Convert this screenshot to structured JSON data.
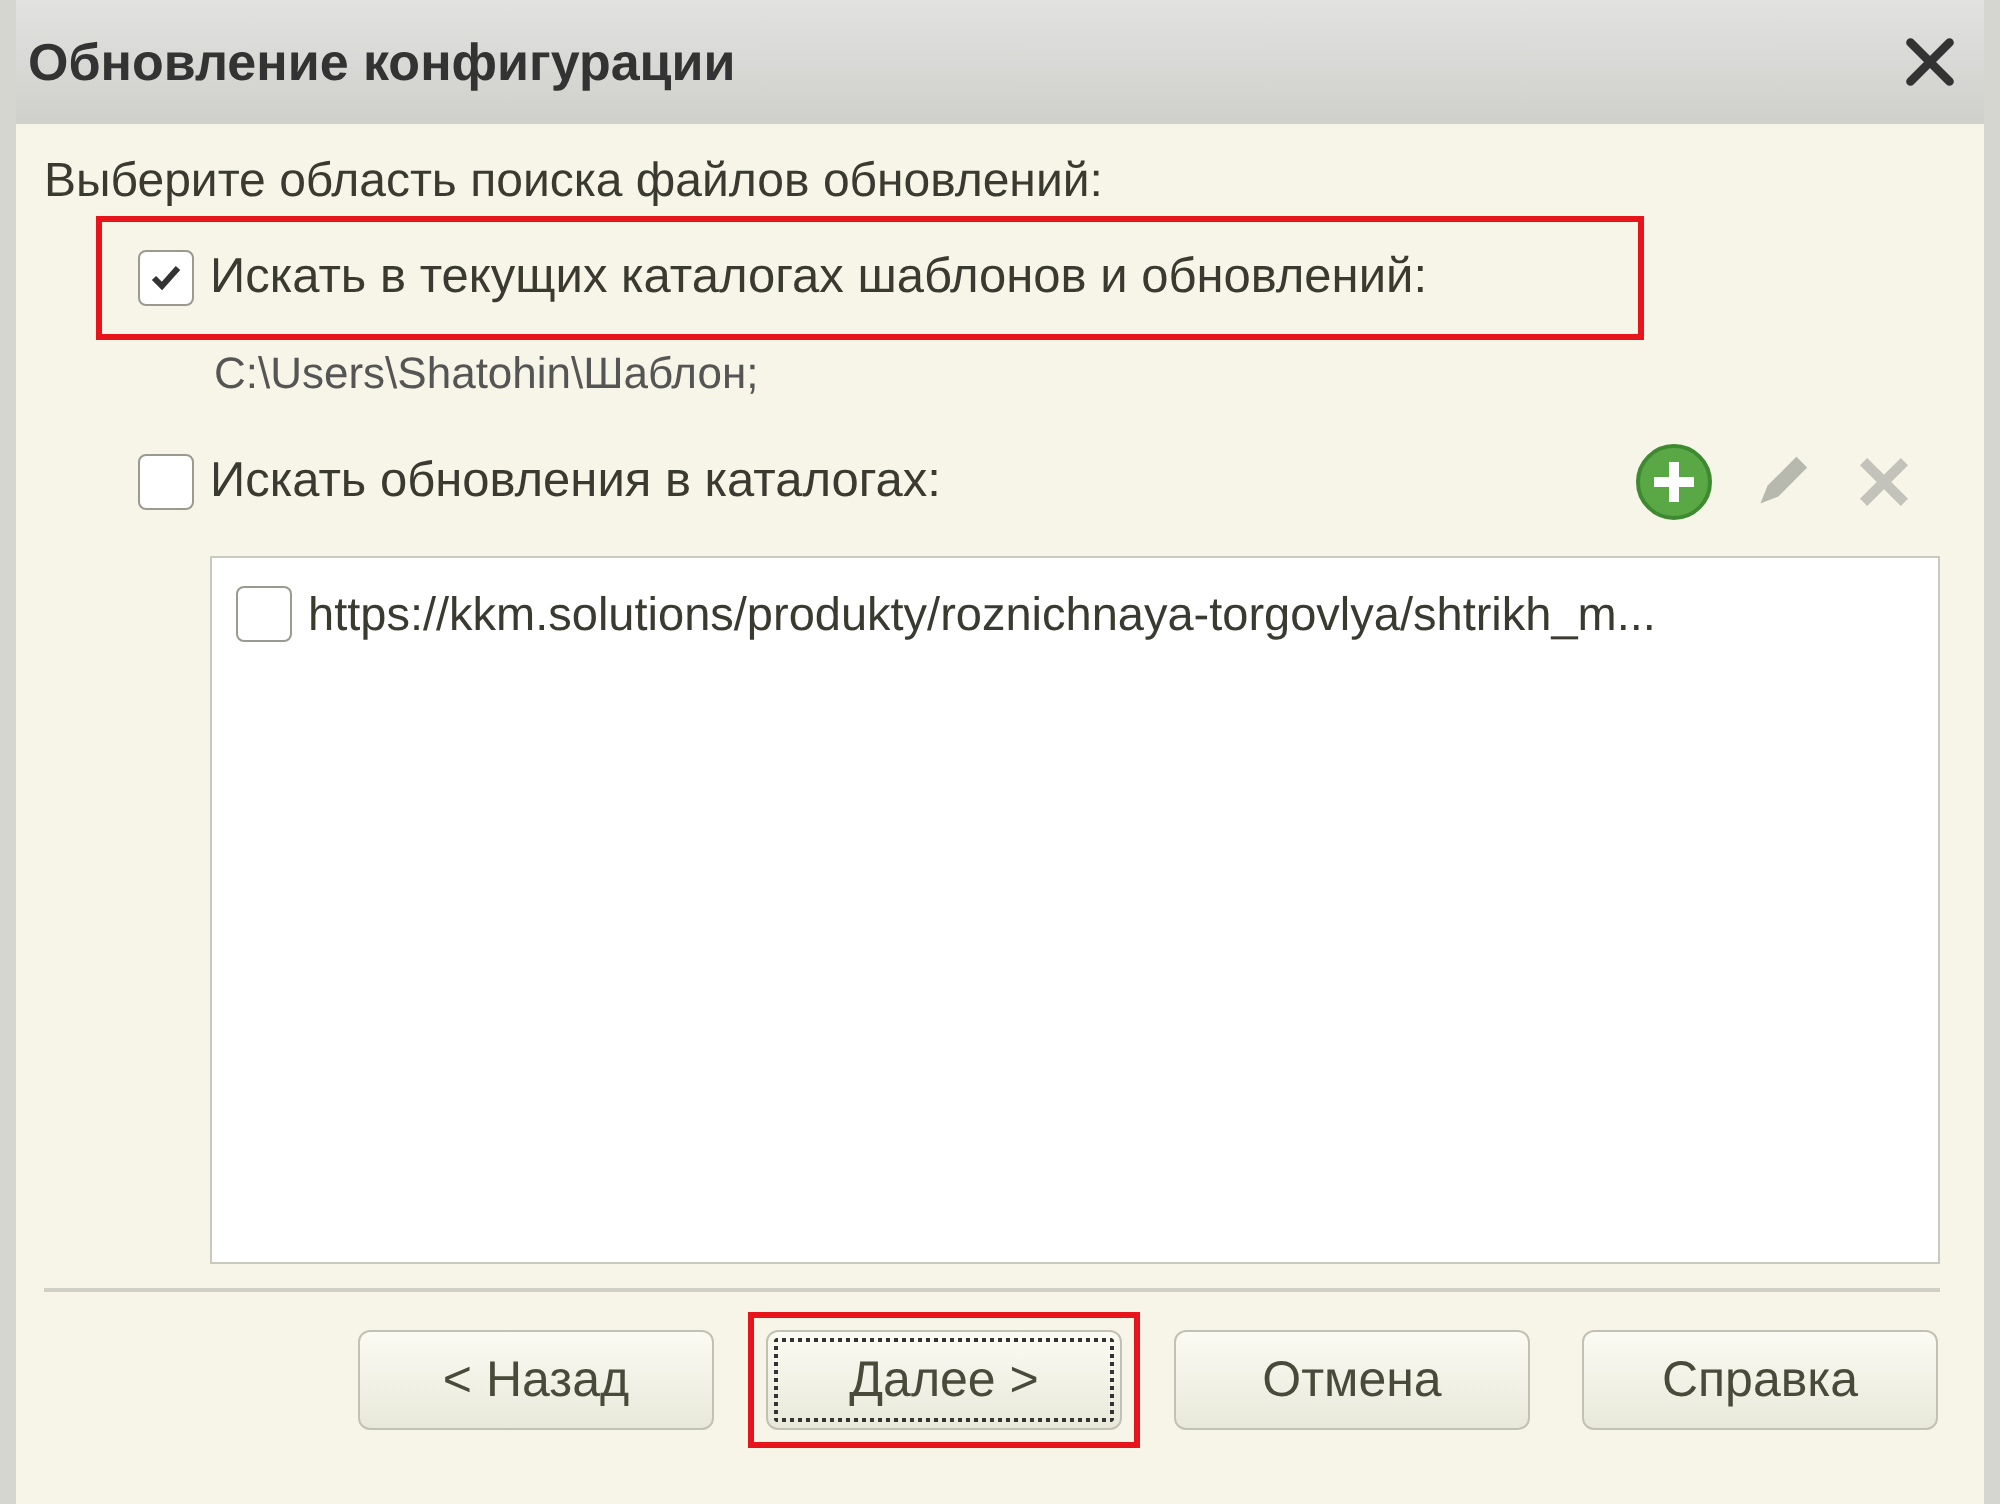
{
  "window": {
    "title": "Обновление конфигурации"
  },
  "prompt": "Выберите область поиска файлов обновлений:",
  "options": [
    {
      "label": "Искать в текущих каталогах шаблонов и обновлений:",
      "checked": true,
      "highlighted": true,
      "path": "C:\\Users\\Shatohin\\Шаблон;"
    },
    {
      "label": "Искать обновления в каталогах:",
      "checked": false,
      "highlighted": false
    }
  ],
  "catalog_items": [
    {
      "url": "https://kkm.solutions/produkty/roznichnaya-torgovlya/shtrikh_m...",
      "checked": false
    }
  ],
  "buttons": [
    {
      "label": "< Назад",
      "focused": false,
      "highlighted": false
    },
    {
      "label": "Далее >",
      "focused": true,
      "highlighted": true
    },
    {
      "label": "Отмена",
      "focused": false,
      "highlighted": false
    },
    {
      "label": "Справка",
      "focused": false,
      "highlighted": false
    }
  ]
}
